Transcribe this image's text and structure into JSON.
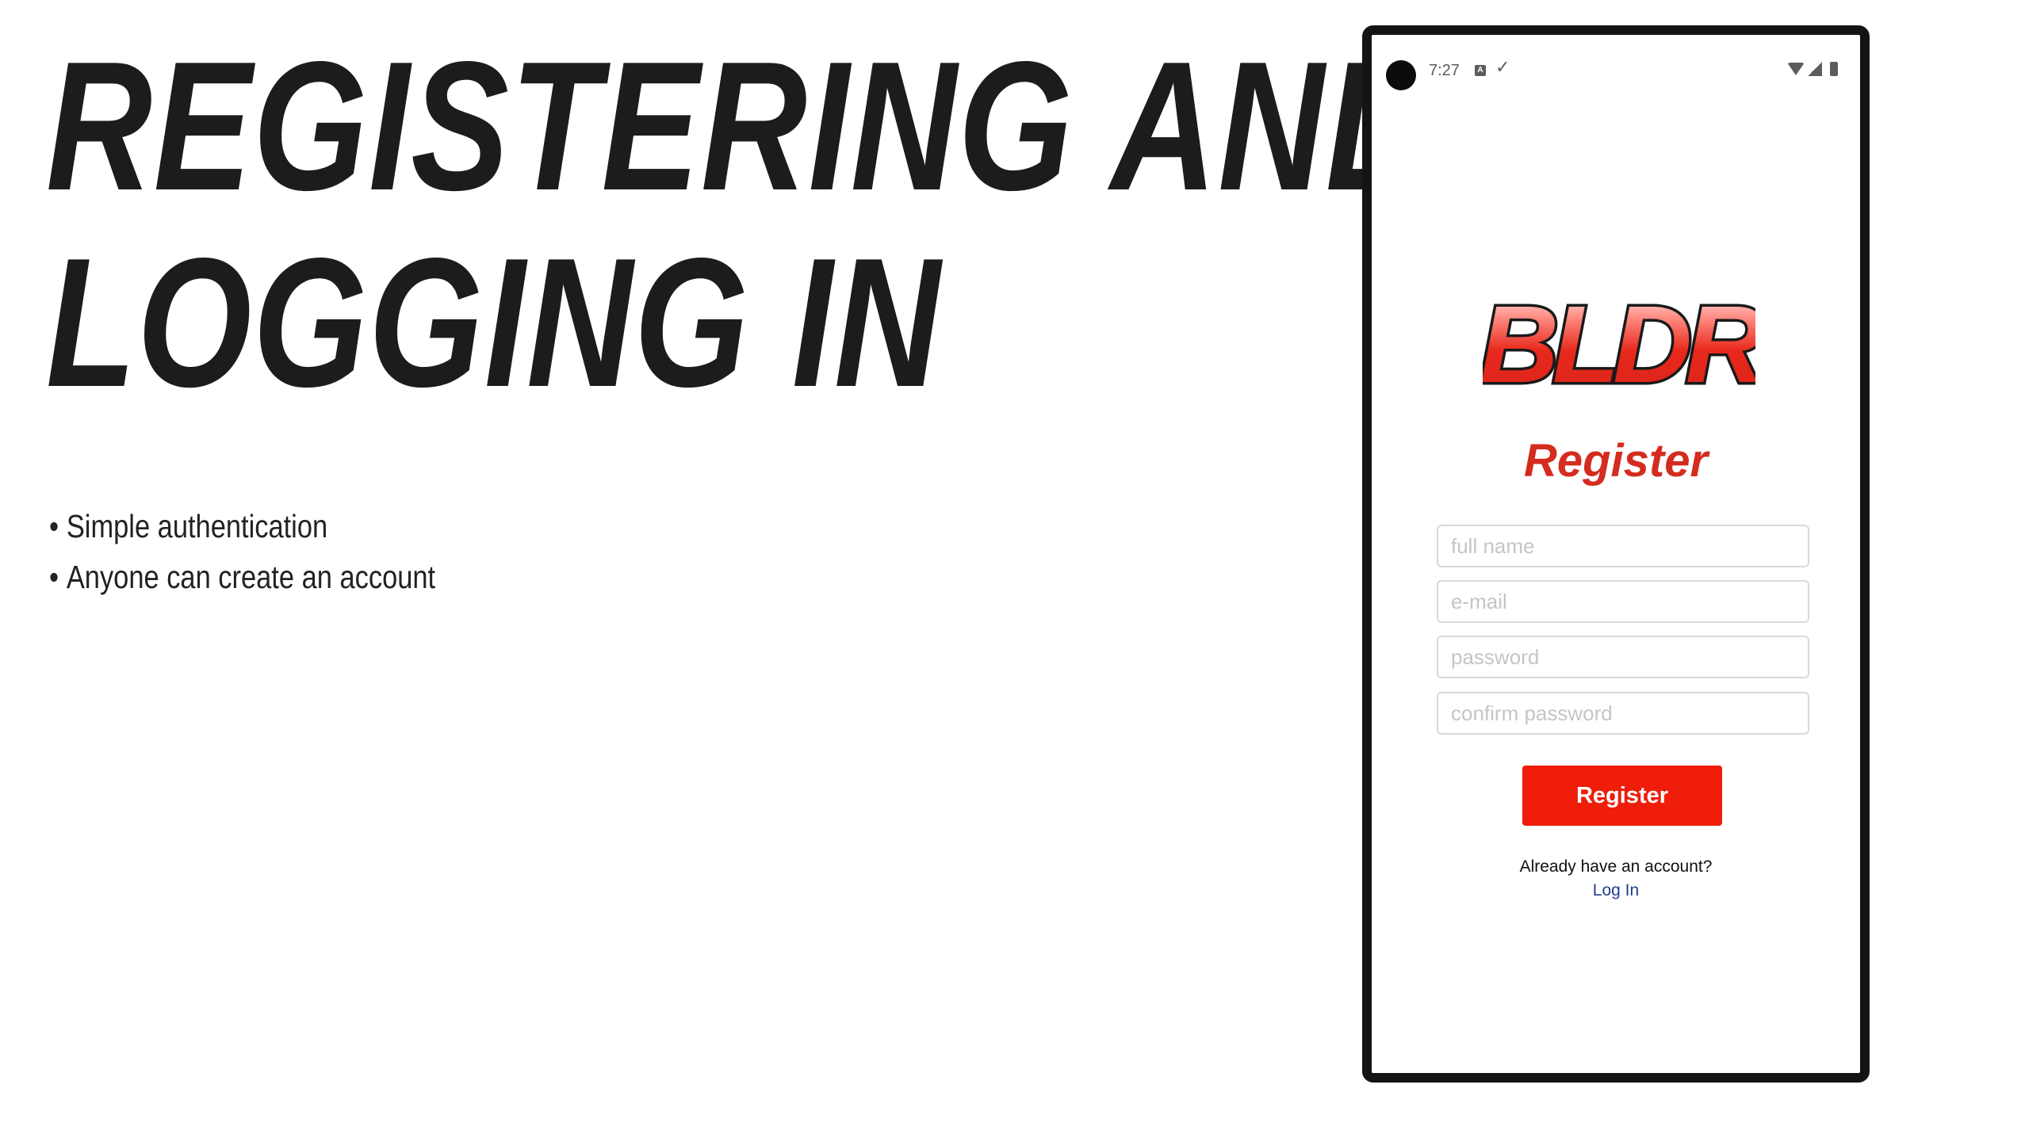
{
  "slide": {
    "title_line1": "REGISTERING AND",
    "title_line2": "LOGGING IN",
    "bullets": [
      "Simple authentication",
      "Anyone can create an account"
    ]
  },
  "phone": {
    "status_bar": {
      "time": "7:27"
    },
    "logo_text": "BLDR",
    "title": "Register",
    "fields": {
      "full_name_placeholder": "full name",
      "email_placeholder": "e-mail",
      "password_placeholder": "password",
      "confirm_password_placeholder": "confirm password"
    },
    "register_button": "Register",
    "already_text": "Already have an account?",
    "login_link": "Log In"
  },
  "colors": {
    "title_text": "#1b1d1b",
    "accent_red": "#ef1d0a",
    "register_title_red": "#d42c1e",
    "link_blue": "#1f3f8f"
  }
}
